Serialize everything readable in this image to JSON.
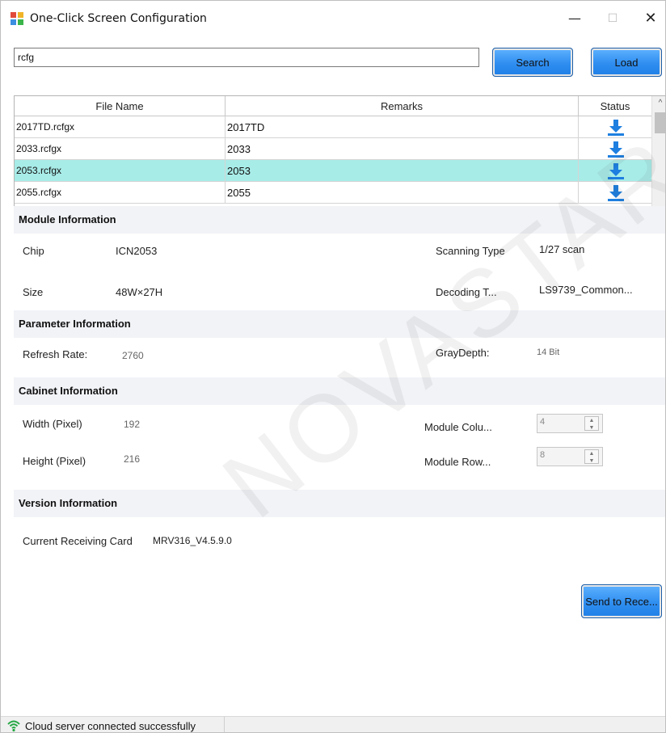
{
  "window": {
    "title": "One-Click Screen Configuration"
  },
  "search": {
    "value": "rcfg",
    "search_label": "Search",
    "load_label": "Load"
  },
  "table": {
    "headers": [
      "File Name",
      "Remarks",
      "Status"
    ],
    "rows": [
      {
        "file": "2017TD.rcfgx",
        "remark": "2017TD",
        "selected": false
      },
      {
        "file": "2033.rcfgx",
        "remark": "2033",
        "selected": false
      },
      {
        "file": "2053.rcfgx",
        "remark": "2053",
        "selected": true
      },
      {
        "file": "2055.rcfgx",
        "remark": "2055",
        "selected": false
      }
    ],
    "status_icon": "download-icon"
  },
  "module": {
    "header": "Module Information",
    "chip_label": "Chip",
    "chip_value": "ICN2053",
    "scan_label": "Scanning Type",
    "scan_value": "1/27 scan",
    "size_label": "Size",
    "size_value": "48W×27H",
    "decoding_label": "Decoding T...",
    "decoding_value": "LS9739_Common..."
  },
  "parameter": {
    "header": "Parameter Information",
    "refresh_label": "Refresh Rate:",
    "refresh_value": "2760",
    "gray_label": "GrayDepth:",
    "gray_value": "14 Bit"
  },
  "cabinet": {
    "header": "Cabinet Information",
    "width_label": "Width (Pixel)",
    "width_value": "192",
    "height_label": "Height (Pixel)",
    "height_value": "216",
    "cols_label": "Module Colu...",
    "cols_value": "4",
    "rows_label": "Module Row...",
    "rows_value": "8"
  },
  "version": {
    "header": "Version Information",
    "card_label": "Current Receiving Card",
    "card_value": "MRV316_V4.5.9.0"
  },
  "actions": {
    "send_label": "Send to Rece..."
  },
  "status": {
    "text": "Cloud server connected successfully",
    "icon": "wifi-icon"
  },
  "watermark": "NOVASTAR TECH C",
  "colors": {
    "button_blue": "#2f8ef0",
    "selected_row": "#a8ece8",
    "section_bg": "#f2f3f7",
    "download_blue": "#1e7fe0"
  }
}
